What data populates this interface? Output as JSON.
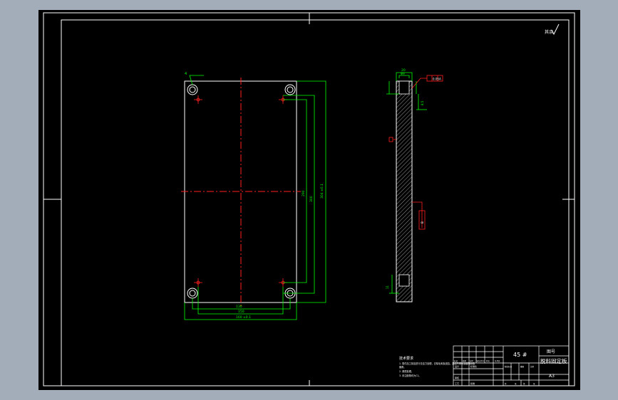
{
  "colors": {
    "background": "#000000",
    "frame": "#ffffff",
    "dimension": "#00ff00",
    "centerline": "#ff2020",
    "annotation_box": "#ff2020",
    "hatch": "#ffffff",
    "outer_background": "#a3adb9"
  },
  "drawing": {
    "roughness_note": "其余",
    "front_view": {
      "dims": {
        "width_outer": "160 ±0.1",
        "width_mid": "150",
        "width_inner": "130",
        "height_outer": "304 ±0.1",
        "height_mid": "300",
        "height_inner": "290"
      },
      "hole_label": "4"
    },
    "side_view": {
      "thickness": "20",
      "counterbore": "Φ9",
      "depth": "8.5",
      "tolerance_tag": "A",
      "datum_tag": "0.05",
      "side_flag": "B",
      "bottom_dim": "11"
    },
    "notes": {
      "title": "技术要求",
      "lines": [
        "1. 零件加工前应进行去应力处理，去除毛刺及锐边，表面不得有划痕等缺陷",
        "   倒角。",
        "2. 调质处理。",
        "3. 未注倒角均为C1。"
      ]
    },
    "title_block": {
      "material": "45 #",
      "scale_label": "图号",
      "part_name": "脱料固定板",
      "sheet": "A3",
      "col_labels": [
        "标记",
        "处数",
        "分区",
        "更改文件号",
        "签名",
        "年月日"
      ],
      "row_labels": [
        "设计",
        "审核",
        "工艺",
        "批准"
      ],
      "small_labels": [
        "阶段标记",
        "重量",
        "比例",
        "共",
        "张",
        "第",
        "张"
      ],
      "std": "标准化"
    }
  }
}
